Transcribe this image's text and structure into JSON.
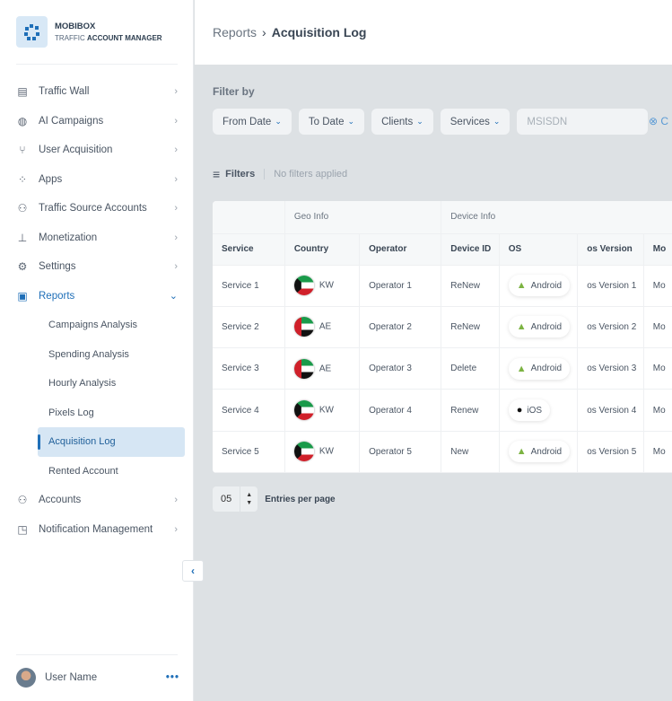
{
  "brand": {
    "name": "MOBIBOX",
    "tag_light": "TRAFFIC",
    "tag_bold": "ACCOUNT MANAGER"
  },
  "nav": [
    {
      "label": "Traffic Wall",
      "icon": "table-icon"
    },
    {
      "label": "AI Campaigns",
      "icon": "globe-icon"
    },
    {
      "label": "User Acquisition",
      "icon": "branch-icon"
    },
    {
      "label": "Apps",
      "icon": "apps-icon"
    },
    {
      "label": "Traffic Source Accounts",
      "icon": "users-icon"
    },
    {
      "label": "Monetization",
      "icon": "hierarchy-icon"
    },
    {
      "label": "Settings",
      "icon": "gear-icon"
    },
    {
      "label": "Reports",
      "icon": "clipboard-icon",
      "expanded": true,
      "children": [
        "Campaigns Analysis",
        "Spending Analysis",
        "Hourly Analysis",
        "Pixels Log",
        "Acquisition Log",
        "Rented Account"
      ],
      "active_child": "Acquisition Log"
    },
    {
      "label": "Accounts",
      "icon": "accounts-icon"
    },
    {
      "label": "Notification Management",
      "icon": "notification-icon"
    }
  ],
  "user": {
    "name": "User Name"
  },
  "breadcrumb": {
    "parent": "Reports",
    "current": "Acquisition Log"
  },
  "filter": {
    "title": "Filter by",
    "from_date": "From Date",
    "to_date": "To Date",
    "clients": "Clients",
    "services": "Services",
    "msisdn_placeholder": "MSISDN",
    "clear": "C",
    "filters_label": "Filters",
    "status": "No filters applied"
  },
  "table": {
    "groups": [
      "",
      "Geo Info",
      "Device Info"
    ],
    "columns": [
      "Service",
      "Country",
      "Operator",
      "Device ID",
      "OS",
      "os Version",
      "Mo"
    ],
    "rows": [
      [
        "Service 1",
        "KW",
        "Operator 1",
        "ReNew",
        "Android",
        "os Version 1",
        "Mo"
      ],
      [
        "Service 2",
        "AE",
        "Operator 2",
        "ReNew",
        "Android",
        "os Version 2",
        "Mo"
      ],
      [
        "Service 3",
        "AE",
        "Operator 3",
        "Delete",
        "Android",
        "os Version 3",
        "Mo"
      ],
      [
        "Service 4",
        "KW",
        "Operator 4",
        "Renew",
        "iOS",
        "os Version 4",
        "Mo"
      ],
      [
        "Service 5",
        "KW",
        "Operator 5",
        "New",
        "Android",
        "os Version 5",
        "Mo"
      ]
    ]
  },
  "pagination": {
    "value": "05",
    "label": "Entries per page"
  },
  "colors": {
    "accent": "#1f6fb8",
    "active_bg": "#d6e6f4",
    "background": "#dde1e4"
  }
}
